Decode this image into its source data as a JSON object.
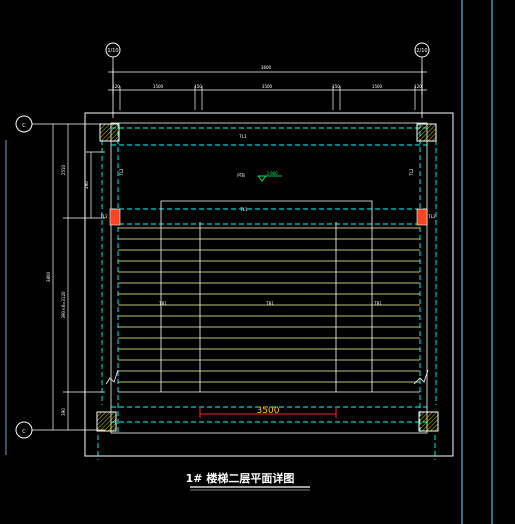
{
  "drawing": {
    "title": "1# 楼梯二层平面详图",
    "axis_top_left": "1/10",
    "axis_top_right": "2/10",
    "axis_left_top": "C",
    "axis_left_bottom": "C",
    "dim_top_total": "3600",
    "dim_top_segments": [
      "120",
      "1500",
      "150",
      "3500",
      "150",
      "1500",
      "120"
    ],
    "dim_left_total": "3800",
    "dim_left_upper": "2510",
    "dim_left_mid": "290",
    "dim_left_flight": "390×8=3120",
    "dim_left_bottom": "390",
    "beam_top": "TL1",
    "beam_mid": "TL1",
    "col_tag_left": "TL2",
    "col_tag_right": "TL2",
    "col_upper_left": "TL2",
    "col_upper_right": "TL2",
    "slab_tag": "PTB",
    "elevation": "3.900",
    "flight_left": "TB1",
    "flight_mid": "TB1",
    "flight_right": "TB1",
    "bottom_dim": "3500"
  },
  "colors": {
    "background": "#000000",
    "lines": "#ffffff",
    "beams": "#00ffff",
    "treads": "#ffff99",
    "columns": "#ffffff",
    "column_hatch": "#ffff00",
    "column_red": "#ff4422",
    "dimension_red": "#ff2222",
    "elevation": "#00ff66"
  }
}
